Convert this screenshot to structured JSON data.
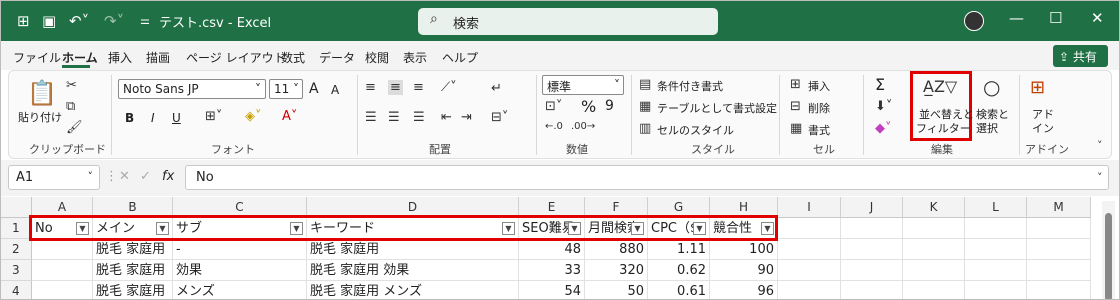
{
  "title_bar": {
    "file_title": "テスト.csv  -  Excel",
    "search_placeholder": "検索",
    "minimize": "—",
    "maximize": "☐",
    "close": "✕"
  },
  "menu": {
    "items": [
      "ファイル",
      "ホーム",
      "挿入",
      "描画",
      "ページ レイアウト",
      "数式",
      "データ",
      "校閲",
      "表示",
      "ヘルプ"
    ],
    "share": "共有"
  },
  "ribbon": {
    "clipboard": {
      "paste": "貼り付け",
      "label": "クリップボード"
    },
    "font": {
      "name": "Noto Sans JP",
      "size": "11",
      "grow": "A",
      "shrink": "A",
      "bold": "B",
      "italic": "I",
      "underline": "U",
      "label": "フォント"
    },
    "alignment": {
      "label": "配置"
    },
    "number": {
      "format": "標準",
      "percent": "%",
      "comma": "9",
      "label": "数値"
    },
    "styles": {
      "conditional": "条件付き書式",
      "table": "テーブルとして書式設定",
      "cell_style": "セルのスタイル",
      "label": "スタイル"
    },
    "cells": {
      "insert": "挿入",
      "delete": "削除",
      "format": "書式",
      "label": "セル"
    },
    "editing": {
      "sum": "Σ",
      "sort_filter_1": "並べ替えと",
      "sort_filter_2": "フィルター",
      "find_1": "検索と",
      "find_2": "選択",
      "label": "編集"
    },
    "addins": {
      "label_1": "アド",
      "label_2": "イン",
      "group": "アドイン"
    }
  },
  "formula_bar": {
    "name_box": "A1",
    "fx": "fx",
    "content": "No"
  },
  "sheet": {
    "columns": [
      "A",
      "B",
      "C",
      "D",
      "E",
      "F",
      "G",
      "H",
      "I",
      "J",
      "K",
      "L",
      "M"
    ],
    "row_numbers": [
      "1",
      "2",
      "3",
      "4"
    ],
    "headers": [
      "No",
      "メイン",
      "サブ",
      "キーワード",
      "SEO難易",
      "月間検索",
      "CPC（$",
      "競合性"
    ],
    "rows": [
      [
        "",
        "脱毛 家庭用",
        "-",
        "脱毛 家庭用",
        "48",
        "880",
        "1.11",
        "100"
      ],
      [
        "",
        "脱毛 家庭用",
        "効果",
        "脱毛 家庭用 効果",
        "33",
        "320",
        "0.62",
        "90"
      ],
      [
        "",
        "脱毛 家庭用",
        "メンズ",
        "脱毛 家庭用 メンズ",
        "54",
        "50",
        "0.61",
        "96"
      ]
    ]
  },
  "colors": {
    "excel_green": "#1f7145",
    "highlight_red": "#e00000"
  }
}
